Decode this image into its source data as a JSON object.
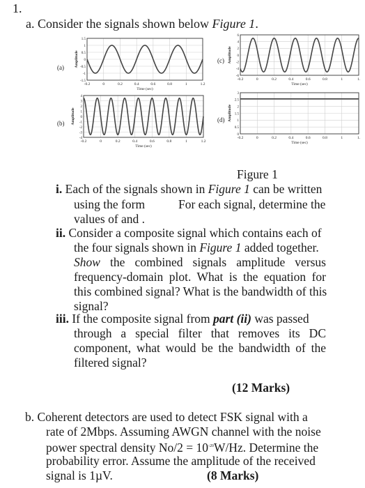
{
  "question": {
    "number": "1.",
    "part_a": {
      "label": "a.",
      "intro_text": "Consider the signals shown below ",
      "intro_ref": "Figure 1",
      "intro_end": ".",
      "figure_caption": "Figure 1",
      "sub_i": {
        "label": "i.",
        "line1_a": "Each of the signals shown in ",
        "line1_ref": "Figure 1",
        "line1_b": " can be written",
        "line2_a": "using the form",
        "line2_b": "For each signal, determine the",
        "line3": "values of and ."
      },
      "sub_ii": {
        "label": "ii.",
        "line1": "Consider a composite signal which contains each of",
        "line2_a": "the four signals shown in ",
        "line2_ref": "Figure 1",
        "line2_b": " added together.",
        "line3_em": "Show",
        "line3_b": " the combined signals amplitude versus",
        "line4": "frequency-domain plot. What is the equation for",
        "line5": "this combined signal? What is the bandwidth of this",
        "line6": "signal?"
      },
      "sub_iii": {
        "label": "iii.",
        "line1_a": "If the composite signal from ",
        "line1_ref": "part (ii)",
        "line1_b": " was passed",
        "line2": "through a special filter that removes its DC",
        "line3": "component, what would be the bandwidth of the",
        "line4": "filtered signal?"
      },
      "marks": "(12 Marks)"
    },
    "part_b": {
      "label": "b.",
      "line1": "Coherent detectors are used to detect FSK signal with a",
      "line2": "rate of 2Mbps. Assuming AWGN channel with the noise",
      "line3_a": "power spectral density No/2 = 10",
      "line3_sup": "-20",
      "line3_b": "W/Hz. Determine the",
      "line4": "probability error. Assume the amplitude of the received",
      "line5": "signal is 1µV.",
      "marks": "(8 Marks)"
    }
  },
  "chart_data": [
    {
      "type": "line",
      "panel": "(a)",
      "xlabel": "Time (sec)",
      "ylabel": "Amplitude",
      "xlim": [
        -0.2,
        1.2
      ],
      "ylim": [
        -1.5,
        1.5
      ],
      "xticks": [
        "-0.2",
        "0",
        "0.2",
        "0.4",
        "0.6",
        "0.8",
        "1",
        "1.2"
      ],
      "yticks": [
        "-1.5",
        "-1",
        "-0.5",
        "0",
        "0.5",
        "1",
        "1.5"
      ],
      "ytick_values": [
        -1.5,
        -1,
        -0.5,
        0,
        0.5,
        1,
        1.5
      ],
      "grid": true,
      "signal": {
        "kind": "sine",
        "amplitude": 1,
        "frequency_hz": 2.5,
        "phase_peak_at": 0.1,
        "offset": 0
      }
    },
    {
      "type": "line",
      "panel": "(b)",
      "xlabel": "Time (sec)",
      "ylabel": "Amplitude",
      "xlim": [
        -0.2,
        1.2
      ],
      "ylim": [
        -4,
        4
      ],
      "xticks": [
        "-0.2",
        "0",
        "0.2",
        "0.4",
        "0.6",
        "0.8",
        "1",
        "1.2"
      ],
      "yticks": [
        "-4",
        "-3",
        "-2",
        "-1",
        "0",
        "1",
        "2",
        "3",
        "4"
      ],
      "ytick_values": [
        -4,
        -3,
        -2,
        -1,
        0,
        1,
        2,
        3,
        4
      ],
      "grid": true,
      "signal": {
        "kind": "sine",
        "amplitude": 3.5,
        "frequency_hz": 6.25,
        "phase_peak_at": 0.12,
        "offset": 0
      }
    },
    {
      "type": "line",
      "panel": "(c)",
      "xlabel": "Time (sec)",
      "ylabel": "Amplitude",
      "xlim": [
        -0.2,
        1.2
      ],
      "ylim": [
        -6,
        6
      ],
      "xticks": [
        "-0.2",
        "0",
        "0.2",
        "0.4",
        "0.6",
        "0.8",
        "1",
        "1."
      ],
      "yticks": [
        "-6",
        "-4",
        "-2",
        "0",
        "2",
        "4",
        "6"
      ],
      "ytick_values": [
        -6,
        -4,
        -2,
        0,
        2,
        4,
        6
      ],
      "grid": true,
      "signal": {
        "kind": "sine",
        "amplitude": 5,
        "frequency_hz": 4,
        "phase_peak_at": 0.2,
        "offset": 0
      }
    },
    {
      "type": "line",
      "panel": "(d)",
      "xlabel": "Time (sec)",
      "ylabel": "Amplitude",
      "xlim": [
        -0.2,
        1.2
      ],
      "ylim": [
        0,
        3
      ],
      "xticks": [
        "-0.2",
        "0",
        "0.2",
        "0.4",
        "0.6",
        "0.8",
        "1",
        "1."
      ],
      "yticks": [
        "0",
        "0.5",
        "1",
        "1.5",
        "2",
        "2.5",
        "3"
      ],
      "ytick_values": [
        0,
        0.5,
        1,
        1.5,
        2,
        2.5,
        3
      ],
      "grid": true,
      "signal": {
        "kind": "constant",
        "amplitude": 0,
        "frequency_hz": 0,
        "phase_peak_at": 0,
        "offset": 2.55
      }
    }
  ]
}
